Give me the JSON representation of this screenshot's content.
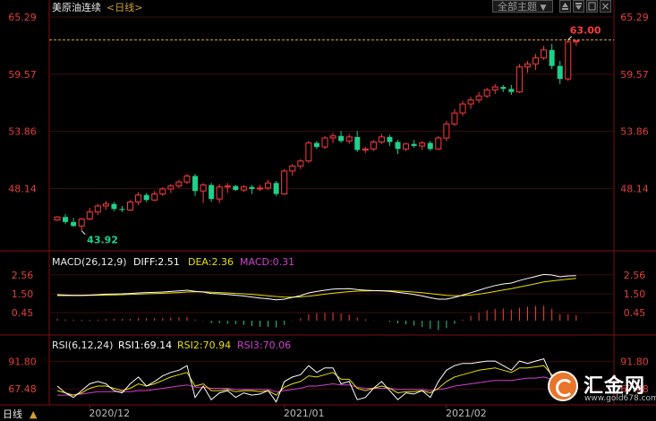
{
  "header": {
    "title": "美原油连续",
    "period_tag": "<日线>",
    "theme_selector": "全部主题",
    "theme_arrow": "▼"
  },
  "badge_left": "日线",
  "badge_arrow": "▲",
  "colors": {
    "up": "#ff3b3b",
    "down": "#1fd08a",
    "axis_text": "#e0403a",
    "date_text": "#bbbbbb",
    "diff": "#ffffff",
    "dea": "#e8e000",
    "rsi1": "#ffffff",
    "rsi2": "#e8e000",
    "rsi3": "#d040d0"
  },
  "icons": [
    "panel-up-icon",
    "panel-down-icon",
    "window-icon",
    "close-icon"
  ],
  "logo": {
    "name": "汇金网",
    "url": "www.gold678.com"
  },
  "chart_data": [
    {
      "type": "candlestick",
      "title": "美原油连续",
      "yticks": [
        "65.29",
        "59.57",
        "53.86",
        "48.14"
      ],
      "ylim": [
        42.1,
        65.29
      ],
      "xticks": [
        "2020/12",
        "2021/01",
        "2021/02"
      ],
      "x_tick_index": [
        4,
        28,
        48
      ],
      "max_label": "63.00",
      "min_label": "43.92",
      "last_price": 63.0,
      "candles": [
        [
          45.0,
          45.4,
          44.9,
          45.3
        ],
        [
          45.3,
          45.6,
          44.6,
          44.8
        ],
        [
          44.8,
          45.2,
          44.3,
          44.4
        ],
        [
          44.4,
          45.2,
          43.92,
          45.1
        ],
        [
          45.1,
          46.2,
          45.0,
          45.8
        ],
        [
          45.8,
          46.6,
          45.5,
          46.4
        ],
        [
          46.4,
          46.9,
          46.0,
          46.6
        ],
        [
          46.6,
          46.8,
          45.9,
          46.1
        ],
        [
          46.1,
          46.4,
          45.8,
          46.0
        ],
        [
          46.0,
          47.0,
          45.9,
          46.8
        ],
        [
          46.8,
          47.8,
          46.5,
          47.5
        ],
        [
          47.5,
          47.7,
          46.8,
          47.0
        ],
        [
          47.0,
          47.9,
          46.9,
          47.6
        ],
        [
          47.6,
          48.3,
          47.4,
          48.1
        ],
        [
          48.1,
          48.6,
          47.7,
          48.4
        ],
        [
          48.4,
          49.0,
          48.2,
          48.8
        ],
        [
          48.8,
          49.6,
          48.6,
          49.4
        ],
        [
          49.4,
          49.6,
          47.4,
          47.9
        ],
        [
          47.9,
          48.7,
          46.7,
          48.5
        ],
        [
          48.5,
          48.7,
          46.8,
          47.1
        ],
        [
          47.1,
          48.6,
          46.7,
          48.3
        ],
        [
          48.3,
          48.7,
          47.7,
          48.4
        ],
        [
          48.4,
          48.5,
          47.9,
          48.0
        ],
        [
          48.0,
          48.5,
          47.8,
          48.3
        ],
        [
          48.3,
          48.5,
          47.6,
          48.1
        ],
        [
          48.1,
          48.5,
          47.9,
          48.2
        ],
        [
          48.2,
          49.0,
          48.0,
          48.7
        ],
        [
          48.7,
          48.9,
          47.4,
          47.6
        ],
        [
          47.6,
          50.1,
          47.5,
          49.9
        ],
        [
          49.9,
          50.6,
          49.4,
          50.4
        ],
        [
          50.4,
          51.1,
          50.1,
          50.9
        ],
        [
          50.9,
          52.9,
          50.7,
          52.7
        ],
        [
          52.7,
          52.9,
          52.1,
          52.3
        ],
        [
          52.3,
          53.4,
          52.1,
          53.2
        ],
        [
          53.2,
          53.7,
          52.7,
          53.4
        ],
        [
          53.4,
          53.9,
          52.7,
          52.9
        ],
        [
          52.9,
          53.6,
          52.6,
          53.3
        ],
        [
          53.3,
          53.9,
          51.8,
          52.0
        ],
        [
          52.0,
          52.3,
          51.7,
          52.1
        ],
        [
          52.1,
          53.0,
          51.9,
          52.8
        ],
        [
          52.8,
          53.6,
          52.6,
          53.3
        ],
        [
          53.3,
          53.5,
          52.4,
          52.8
        ],
        [
          52.8,
          53.0,
          51.6,
          52.1
        ],
        [
          52.1,
          52.7,
          51.9,
          52.6
        ],
        [
          52.6,
          53.0,
          52.2,
          52.4
        ],
        [
          52.4,
          52.9,
          52.0,
          52.7
        ],
        [
          52.7,
          52.9,
          51.9,
          52.1
        ],
        [
          52.1,
          53.4,
          52.0,
          53.2
        ],
        [
          53.2,
          54.9,
          52.9,
          54.6
        ],
        [
          54.6,
          56.1,
          54.4,
          55.7
        ],
        [
          55.7,
          56.9,
          55.4,
          56.6
        ],
        [
          56.6,
          57.3,
          56.1,
          57.0
        ],
        [
          57.0,
          57.8,
          56.7,
          57.4
        ],
        [
          57.4,
          58.2,
          57.2,
          58.0
        ],
        [
          58.0,
          58.6,
          57.6,
          58.3
        ],
        [
          58.3,
          58.5,
          57.8,
          58.1
        ],
        [
          58.1,
          58.5,
          57.5,
          57.8
        ],
        [
          57.8,
          60.6,
          57.7,
          60.3
        ],
        [
          60.3,
          60.9,
          59.7,
          60.6
        ],
        [
          60.6,
          61.6,
          60.0,
          61.2
        ],
        [
          61.2,
          62.4,
          61.0,
          62.0
        ],
        [
          62.0,
          62.6,
          60.1,
          60.4
        ],
        [
          60.4,
          60.9,
          58.6,
          59.1
        ],
        [
          59.1,
          63.0,
          58.9,
          62.8
        ],
        [
          62.8,
          63.0,
          62.4,
          62.9
        ]
      ]
    },
    {
      "type": "bar",
      "title": "MACD(26,12,9)",
      "legend": {
        "diff": "DIFF:2.51",
        "dea": "DEA:2.36",
        "macd": "MACD:0.31"
      },
      "yticks": [
        "2.56",
        "1.50",
        "0.45"
      ],
      "ylim": [
        -0.7,
        2.9
      ],
      "diff": [
        1.45,
        1.43,
        1.42,
        1.42,
        1.43,
        1.45,
        1.48,
        1.49,
        1.5,
        1.52,
        1.55,
        1.57,
        1.58,
        1.6,
        1.63,
        1.66,
        1.7,
        1.64,
        1.6,
        1.52,
        1.5,
        1.46,
        1.42,
        1.38,
        1.32,
        1.26,
        1.22,
        1.16,
        1.2,
        1.3,
        1.4,
        1.55,
        1.63,
        1.7,
        1.76,
        1.78,
        1.79,
        1.74,
        1.7,
        1.68,
        1.67,
        1.64,
        1.58,
        1.53,
        1.46,
        1.38,
        1.28,
        1.2,
        1.2,
        1.3,
        1.43,
        1.56,
        1.7,
        1.84,
        1.96,
        2.05,
        2.1,
        2.24,
        2.36,
        2.47,
        2.58,
        2.55,
        2.45,
        2.5,
        2.51
      ],
      "dea": [
        1.4,
        1.4,
        1.4,
        1.4,
        1.41,
        1.42,
        1.43,
        1.44,
        1.45,
        1.47,
        1.48,
        1.5,
        1.51,
        1.53,
        1.55,
        1.57,
        1.6,
        1.61,
        1.61,
        1.59,
        1.57,
        1.55,
        1.52,
        1.5,
        1.47,
        1.43,
        1.39,
        1.35,
        1.32,
        1.31,
        1.33,
        1.37,
        1.42,
        1.48,
        1.53,
        1.58,
        1.62,
        1.65,
        1.66,
        1.67,
        1.67,
        1.67,
        1.65,
        1.63,
        1.6,
        1.56,
        1.51,
        1.46,
        1.41,
        1.39,
        1.4,
        1.43,
        1.48,
        1.55,
        1.63,
        1.71,
        1.79,
        1.88,
        1.97,
        2.06,
        2.16,
        2.22,
        2.27,
        2.32,
        2.36
      ],
      "macd": [
        0.1,
        0.07,
        0.06,
        0.05,
        0.05,
        0.06,
        0.09,
        0.1,
        0.1,
        0.1,
        0.14,
        0.14,
        0.14,
        0.14,
        0.16,
        0.18,
        0.2,
        0.06,
        -0.02,
        -0.14,
        -0.14,
        -0.18,
        -0.2,
        -0.24,
        -0.3,
        -0.34,
        -0.34,
        -0.38,
        -0.24,
        -0.02,
        0.14,
        0.36,
        0.42,
        0.44,
        0.46,
        0.4,
        0.34,
        0.18,
        0.08,
        0.02,
        0.0,
        -0.06,
        -0.14,
        -0.2,
        -0.28,
        -0.36,
        -0.46,
        -0.52,
        -0.42,
        -0.18,
        0.06,
        0.26,
        0.44,
        0.58,
        0.66,
        0.68,
        0.62,
        0.72,
        0.78,
        0.82,
        0.84,
        0.66,
        0.36,
        0.36,
        0.31
      ]
    },
    {
      "type": "line",
      "title": "RSI(6,12,24)",
      "legend": {
        "rsi1": "RSI1:69.14",
        "rsi2": "RSI2:70.94",
        "rsi3": "RSI3:70.06"
      },
      "yticks": [
        "91.80",
        "67.48"
      ],
      "ylim": [
        55,
        100
      ],
      "rsi1": [
        70,
        64,
        60,
        66,
        72,
        74,
        72,
        66,
        64,
        72,
        78,
        70,
        74,
        79,
        82,
        84,
        88,
        60,
        70,
        58,
        64,
        66,
        60,
        64,
        62,
        63,
        66,
        56,
        74,
        78,
        80,
        88,
        82,
        86,
        86,
        72,
        74,
        58,
        60,
        68,
        74,
        66,
        58,
        64,
        63,
        66,
        60,
        74,
        84,
        88,
        90,
        90,
        91,
        92,
        92,
        88,
        84,
        92,
        90,
        92,
        94,
        78,
        62,
        78,
        69.14
      ],
      "rsi2": [
        66,
        64,
        62,
        64,
        68,
        70,
        70,
        68,
        66,
        68,
        72,
        70,
        72,
        75,
        78,
        80,
        82,
        70,
        72,
        66,
        66,
        67,
        65,
        66,
        66,
        65,
        66,
        62,
        69,
        72,
        74,
        79,
        78,
        80,
        82,
        76,
        76,
        68,
        66,
        68,
        70,
        68,
        64,
        65,
        65,
        66,
        64,
        68,
        74,
        78,
        80,
        82,
        84,
        85,
        86,
        84,
        82,
        86,
        86,
        87,
        88,
        80,
        72,
        74,
        70.94
      ],
      "rsi3": [
        62,
        62,
        62,
        63,
        64,
        65,
        65,
        65,
        65,
        65,
        66,
        66,
        67,
        68,
        69,
        70,
        71,
        69,
        69,
        68,
        68,
        68,
        67,
        67,
        67,
        67,
        67,
        65,
        66,
        67,
        68,
        70,
        70,
        71,
        72,
        71,
        71,
        69,
        68,
        68,
        68,
        68,
        67,
        67,
        67,
        67,
        66,
        67,
        68,
        70,
        71,
        72,
        73,
        74,
        75,
        75,
        75,
        76,
        77,
        77,
        78,
        76,
        73,
        72,
        70.06
      ]
    }
  ]
}
